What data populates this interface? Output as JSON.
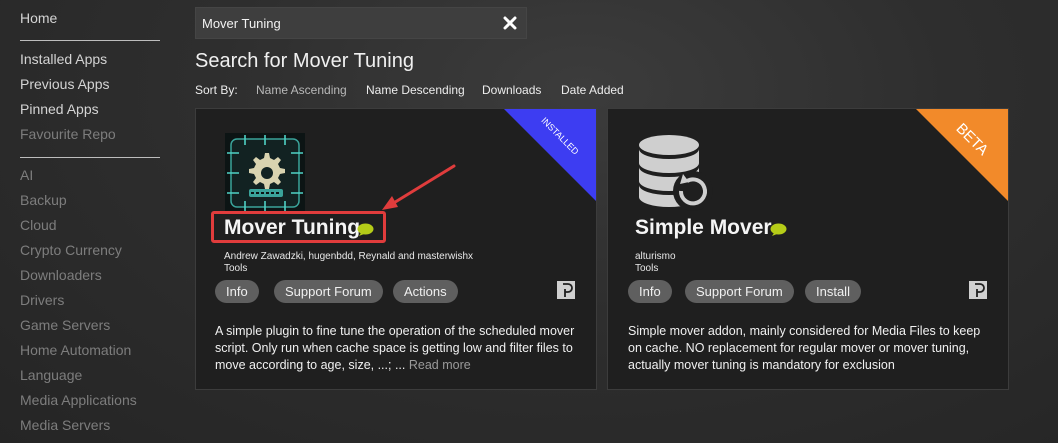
{
  "sidebar": {
    "home": "Home",
    "section1": [
      "Installed Apps",
      "Previous Apps",
      "Pinned Apps",
      "Favourite Repo"
    ],
    "categories": [
      "AI",
      "Backup",
      "Cloud",
      "Crypto Currency",
      "Downloaders",
      "Drivers",
      "Game Servers",
      "Home Automation",
      "Language",
      "Media Applications",
      "Media Servers"
    ]
  },
  "search": {
    "value": "Mover Tuning"
  },
  "heading": "Search for Mover Tuning",
  "sort": {
    "label": "Sort By:",
    "options": [
      "Name Ascending",
      "Name Descending",
      "Downloads",
      "Date Added"
    ]
  },
  "cards": [
    {
      "name": "Mover Tuning",
      "ribbon": "INSTALLED",
      "ribbon_color": "#3d3df2",
      "author": "Andrew Zawadzki, hugenbdd, Reynald and masterwishx",
      "category": "Tools",
      "buttons": [
        "Info",
        "Support Forum",
        "Actions"
      ],
      "description": "A simple plugin to fine tune the operation of the scheduled mover script. Only run when cache space is getting low and filter files to move according to age, size, ...; ...",
      "read_more": "Read more",
      "icon": "gear-circuit-icon"
    },
    {
      "name": "Simple Mover",
      "ribbon": "BETA",
      "ribbon_color": "#f28a2a",
      "author": "alturismo",
      "category": "Tools",
      "buttons": [
        "Info",
        "Support Forum",
        "Install"
      ],
      "description": "Simple mover addon, mainly considered for Media Files to keep on cache. NO replacement for regular mover or mover tuning, actually mover tuning is mandatory for exclusion",
      "icon": "database-refresh-icon"
    }
  ],
  "colors": {
    "accent_chat": "#b5cc18",
    "annotation": "#e03c3c"
  }
}
